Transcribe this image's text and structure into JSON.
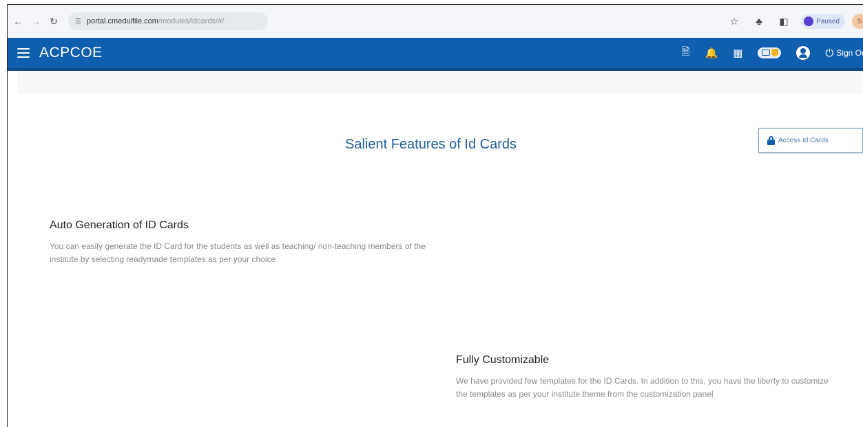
{
  "browser": {
    "url_host": "portal.cmeduifile.com",
    "url_path": "/modules/idcards/#/",
    "profile_label": "Paused",
    "avatar_initial": "S"
  },
  "header": {
    "brand": "ACPCOE",
    "signout_label": "Sign Out"
  },
  "main": {
    "title": "Salient Features of Id Cards",
    "access_button_label": "Access Id Cards",
    "features": [
      {
        "title": "Auto Generation of ID Cards",
        "description": "You can easily generate the ID Card for the students as well as teaching/ non-teaching members of the institute by selecting readymade templates as per your choice"
      },
      {
        "title": "Fully Customizable",
        "description": "We have provided few templates for the ID Cards. In addition to this, you have the liberty to customize the templates as per your institute theme from the customization panel"
      }
    ]
  },
  "colors": {
    "header_bg": "#0f5fae",
    "title_color": "#1f5fa0",
    "accent_gold": "#f2b01e"
  }
}
